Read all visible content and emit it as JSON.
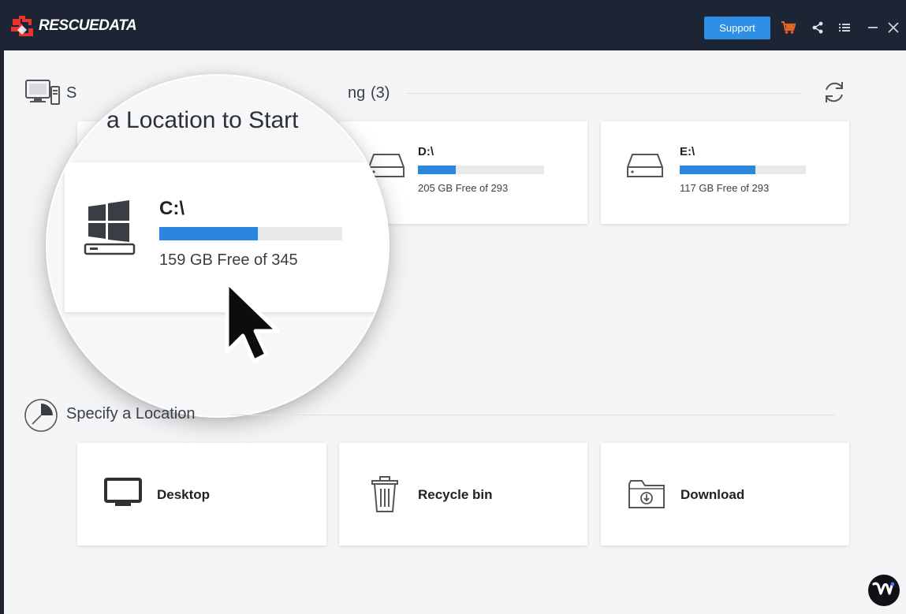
{
  "app": {
    "brand": "RESCUEDATA"
  },
  "titlebar": {
    "support_label": "Support",
    "icons": [
      "cart-icon",
      "share-icon",
      "menu-icon",
      "minimize-icon",
      "close-icon"
    ]
  },
  "drives_section": {
    "title_visible_left": "S",
    "title_visible_right": "ng",
    "count": "(3)"
  },
  "magnifier": {
    "title": "a Location to Start",
    "drive": {
      "name": "C:\\",
      "free_text": "159 GB Free of 345",
      "used_fraction": 0.54
    }
  },
  "drives": [
    {
      "name": "C:\\",
      "free_text": "159 GB Free of 345",
      "used_fraction": 0.54
    },
    {
      "name": "D:\\",
      "free_text": "205 GB Free of 293",
      "used_fraction": 0.3
    },
    {
      "name": "E:\\",
      "free_text": "117 GB Free of 293",
      "used_fraction": 0.6
    }
  ],
  "locations_section": {
    "title": "Specify a Location"
  },
  "locations": [
    {
      "label": "Desktop",
      "icon": "monitor-icon"
    },
    {
      "label": "Recycle bin",
      "icon": "trash-icon"
    },
    {
      "label": "Download",
      "icon": "download-folder-icon"
    }
  ],
  "colors": {
    "accent": "#2a86de",
    "titlebar": "#1d2433",
    "support": "#2f8fe6",
    "cart": "#e0632a"
  }
}
